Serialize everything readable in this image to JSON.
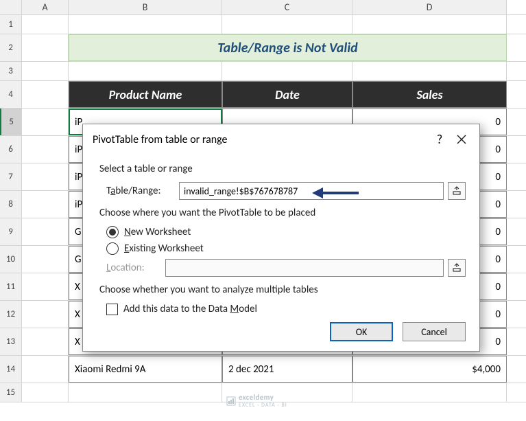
{
  "columns": {
    "A": "A",
    "B": "B",
    "C": "C",
    "D": "D"
  },
  "row_numbers": [
    "1",
    "2",
    "3",
    "4",
    "5",
    "6",
    "7",
    "8",
    "9",
    "10",
    "11",
    "12",
    "13",
    "14",
    "15"
  ],
  "title_banner": "Table/Range is Not Valid",
  "table": {
    "headers": {
      "product": "Product Name",
      "date": "Date",
      "sales": "Sales"
    },
    "partial_rows": {
      "r5": "iP",
      "r6": "iP",
      "r7": "iP",
      "r8": "iP",
      "r9": "G",
      "r10": "G",
      "r11": "X",
      "r12": "X",
      "r13": "X"
    },
    "partial_sales_suffix": "0",
    "row14": {
      "product": "Xiaomi Redmi 9A",
      "date": "2 dec 2021",
      "sales": "$4,000"
    }
  },
  "dialog": {
    "title": "PivotTable from table or range",
    "section_select": "Select a table or range",
    "table_range_label_pre": "T",
    "table_range_label_u": "a",
    "table_range_label_post": "ble/Range:",
    "table_range_value": "invalid_range!$B$767678787",
    "section_place": "Choose where you want the PivotTable to be placed",
    "new_ws_pre": "",
    "new_ws_u": "N",
    "new_ws_post": "ew Worksheet",
    "existing_ws_pre": "",
    "existing_ws_u": "E",
    "existing_ws_post": "xisting Worksheet",
    "location_pre": "",
    "location_u": "L",
    "location_post": "ocation:",
    "section_analyze": "Choose whether you want to analyze multiple tables",
    "datamodel_pre": "Add this data to the Data ",
    "datamodel_u": "M",
    "datamodel_post": "odel",
    "ok": "OK",
    "cancel": "Cancel"
  },
  "watermark": {
    "brand": "exceldemy",
    "tagline": "EXCEL · DATA · BI"
  }
}
